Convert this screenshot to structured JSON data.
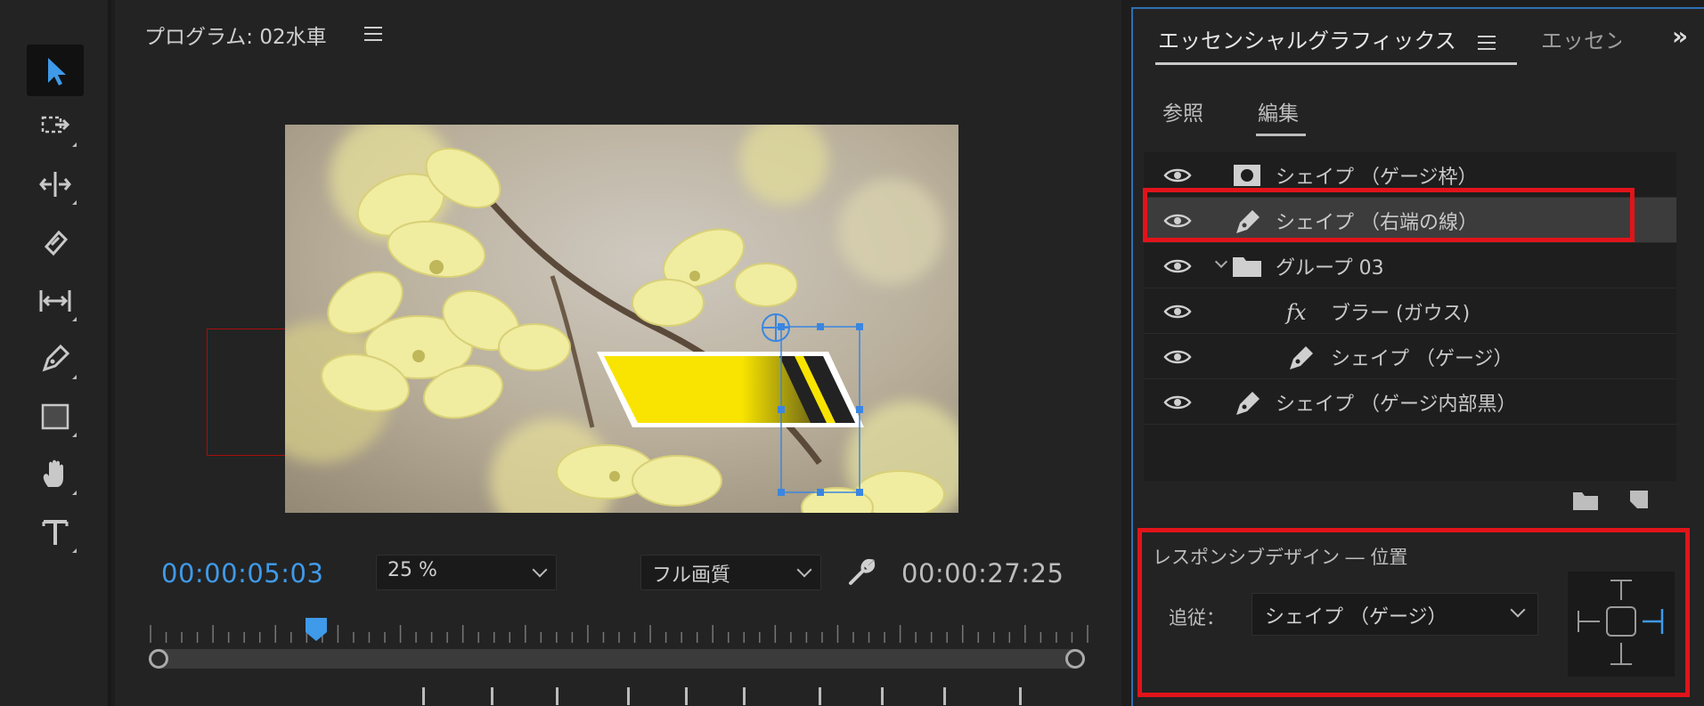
{
  "monitor": {
    "title": "プログラム: 02水車",
    "current_timecode": "00:00:05:03",
    "zoom": "25 %",
    "quality": "フル画質",
    "duration": "00:00:27:25",
    "playhead_fraction": 0.17
  },
  "toolbar": {
    "tools": [
      "selection-tool",
      "track-select-tool",
      "ripple-edit-tool",
      "razor-tool",
      "slip-tool",
      "pen-tool",
      "rectangle-tool",
      "hand-tool",
      "type-tool"
    ],
    "active": "selection-tool"
  },
  "essential_graphics": {
    "tab_label": "エッセンシャルグラフィックス",
    "tab2_label": "エッセン",
    "subtabs": [
      "参照",
      "編集"
    ],
    "active_subtab": "編集",
    "layers": [
      {
        "name": "シェイプ （ゲージ枠）",
        "icon": "mask-icon",
        "selected": false
      },
      {
        "name": "シェイプ （右端の線）",
        "icon": "pen-icon",
        "selected": true
      },
      {
        "name": "グループ 03",
        "icon": "folder-icon",
        "selected": false
      },
      {
        "name": "ブラー (ガウス)",
        "icon": "fx-icon",
        "selected": false
      },
      {
        "name": "シェイプ （ゲージ）",
        "icon": "pen-icon",
        "selected": false
      },
      {
        "name": "シェイプ （ゲージ内部黒）",
        "icon": "pen-icon",
        "selected": false
      }
    ],
    "responsive": {
      "title": "レスポンシブデザイン ― 位置",
      "follow_label": "追従：",
      "follow_value": "シェイプ （ゲージ）"
    }
  },
  "colors": {
    "accent_blue": "#3f9ae9",
    "highlight_red": "#e1141a",
    "gauge_yellow": "#f8e400"
  }
}
